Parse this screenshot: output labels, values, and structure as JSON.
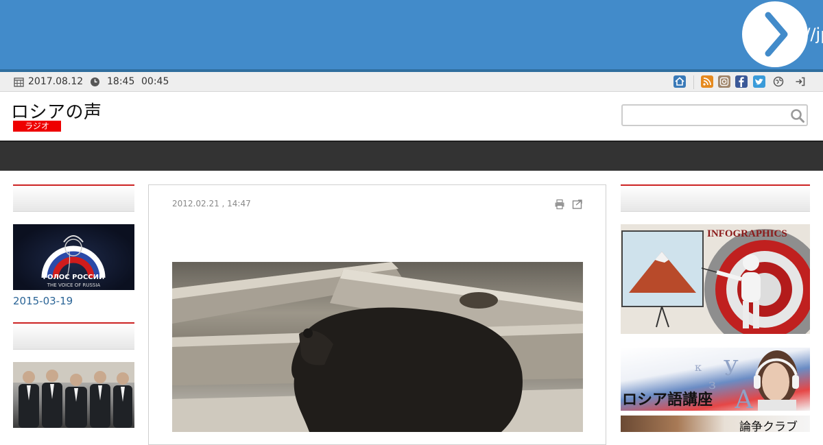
{
  "banner": {
    "archive_link_text": "http://jp"
  },
  "infobar": {
    "date": "2017.08.12",
    "time_1": "18:45",
    "time_2": "00:45"
  },
  "header": {
    "site_title": "ロシアの声",
    "badge": "ラジオ",
    "search_placeholder": ""
  },
  "main": {
    "post_date": "2012.02.21 , 14:47"
  },
  "left_sidebar": {
    "item_1_date": "2015-03-19",
    "logo_text_ru": "ГОЛОС РОССИИ",
    "logo_text_en": "THE VOICE OF RUSSIA"
  },
  "right_sidebar": {
    "infographics_label": "INFOGRAPHICS",
    "lang_course_label": "ロシア語講座",
    "debate_club_label": "論争クラブ"
  },
  "colors": {
    "banner": "#428bca",
    "accent_red": "#cc2222",
    "nav": "#333333",
    "link": "#2a6496"
  }
}
